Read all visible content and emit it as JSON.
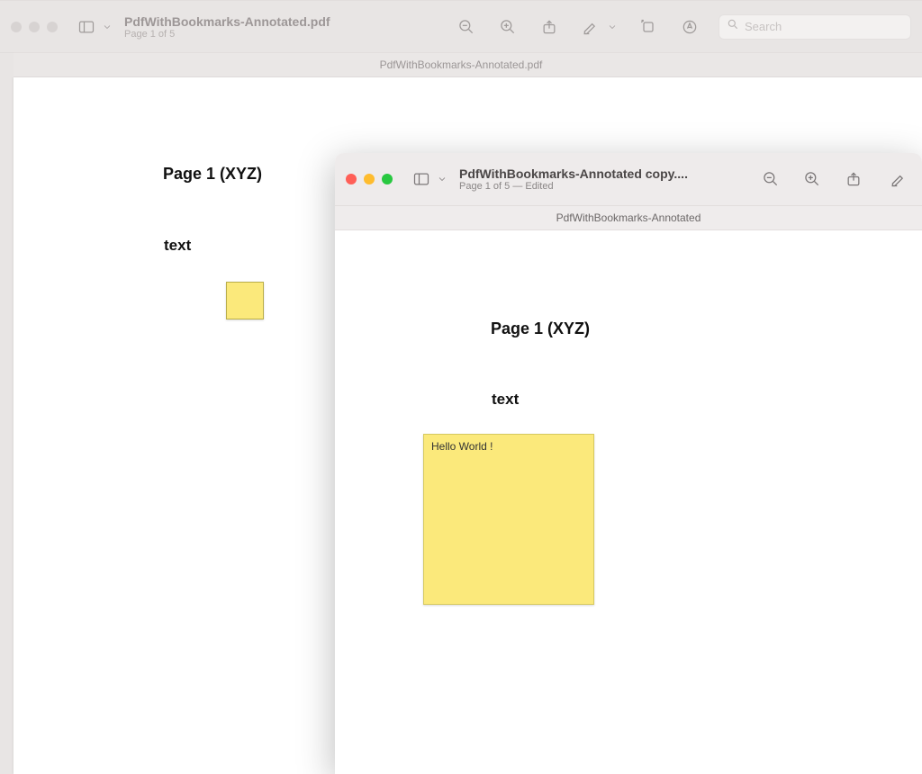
{
  "back_window": {
    "title": "PdfWithBookmarks-Annotated.pdf",
    "subtitle": "Page 1 of 5",
    "tab_label": "PdfWithBookmarks-Annotated.pdf",
    "search_placeholder": "Search",
    "doc": {
      "heading": "Page 1 (XYZ)",
      "text": "text"
    }
  },
  "front_window": {
    "title": "PdfWithBookmarks-Annotated copy....",
    "subtitle": "Page 1 of 5 — Edited",
    "tab_label": "PdfWithBookmarks-Annotated",
    "doc": {
      "heading": "Page 1 (XYZ)",
      "text": "text",
      "note_text": "Hello World !"
    }
  }
}
